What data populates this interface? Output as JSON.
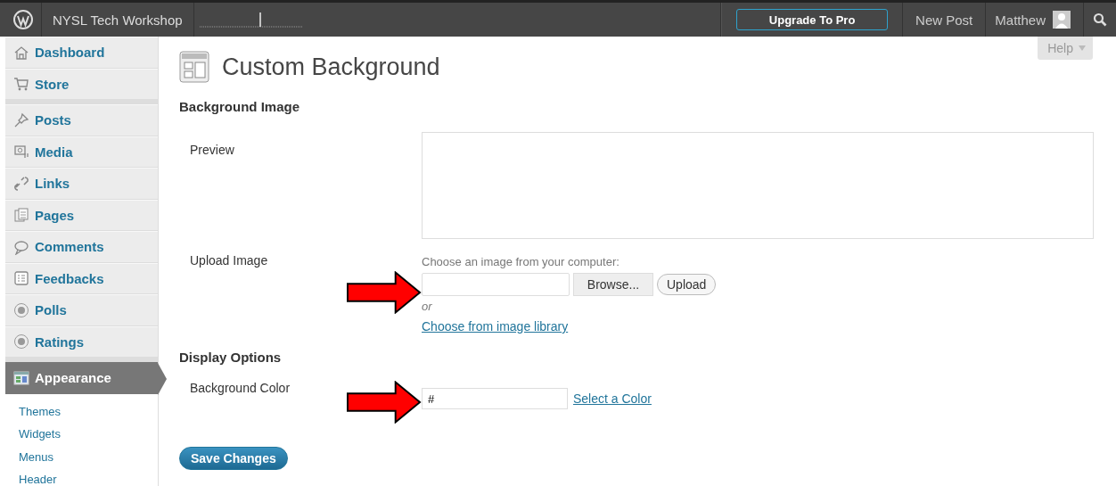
{
  "topbar": {
    "site_name": "NYSL Tech Workshop",
    "upgrade_button": "Upgrade To Pro",
    "new_post": "New Post",
    "user_name": "Matthew"
  },
  "help_tab": {
    "label": "Help"
  },
  "sidebar": {
    "groups": [
      {
        "items": [
          {
            "label": "Dashboard",
            "selected": false
          },
          {
            "label": "Store",
            "selected": false
          }
        ]
      },
      {
        "items": [
          {
            "label": "Posts",
            "selected": false
          },
          {
            "label": "Media",
            "selected": false
          },
          {
            "label": "Links",
            "selected": false
          },
          {
            "label": "Pages",
            "selected": false
          },
          {
            "label": "Comments",
            "selected": false
          },
          {
            "label": "Feedbacks",
            "selected": false
          },
          {
            "label": "Polls",
            "selected": false
          },
          {
            "label": "Ratings",
            "selected": false
          }
        ]
      },
      {
        "items": [
          {
            "label": "Appearance",
            "selected": true,
            "children": [
              {
                "label": "Themes"
              },
              {
                "label": "Widgets"
              },
              {
                "label": "Menus"
              },
              {
                "label": "Header"
              }
            ]
          }
        ]
      }
    ]
  },
  "page": {
    "title": "Custom Background",
    "sections": [
      {
        "heading": "Background Image",
        "rows": [
          {
            "kind": "preview",
            "label": "Preview",
            "arrow": false
          },
          {
            "kind": "upload",
            "label": "Upload Image",
            "arrow": true,
            "hint": "Choose an image from your computer:",
            "browse_button": "Browse...",
            "upload_button": "Upload",
            "or": "or",
            "link": "Choose from image library"
          }
        ]
      },
      {
        "heading": "Display Options",
        "rows": [
          {
            "kind": "color",
            "label": "Background Color",
            "arrow": true,
            "value": "#",
            "link": "Select a Color"
          }
        ]
      }
    ],
    "save_button": "Save Changes"
  }
}
